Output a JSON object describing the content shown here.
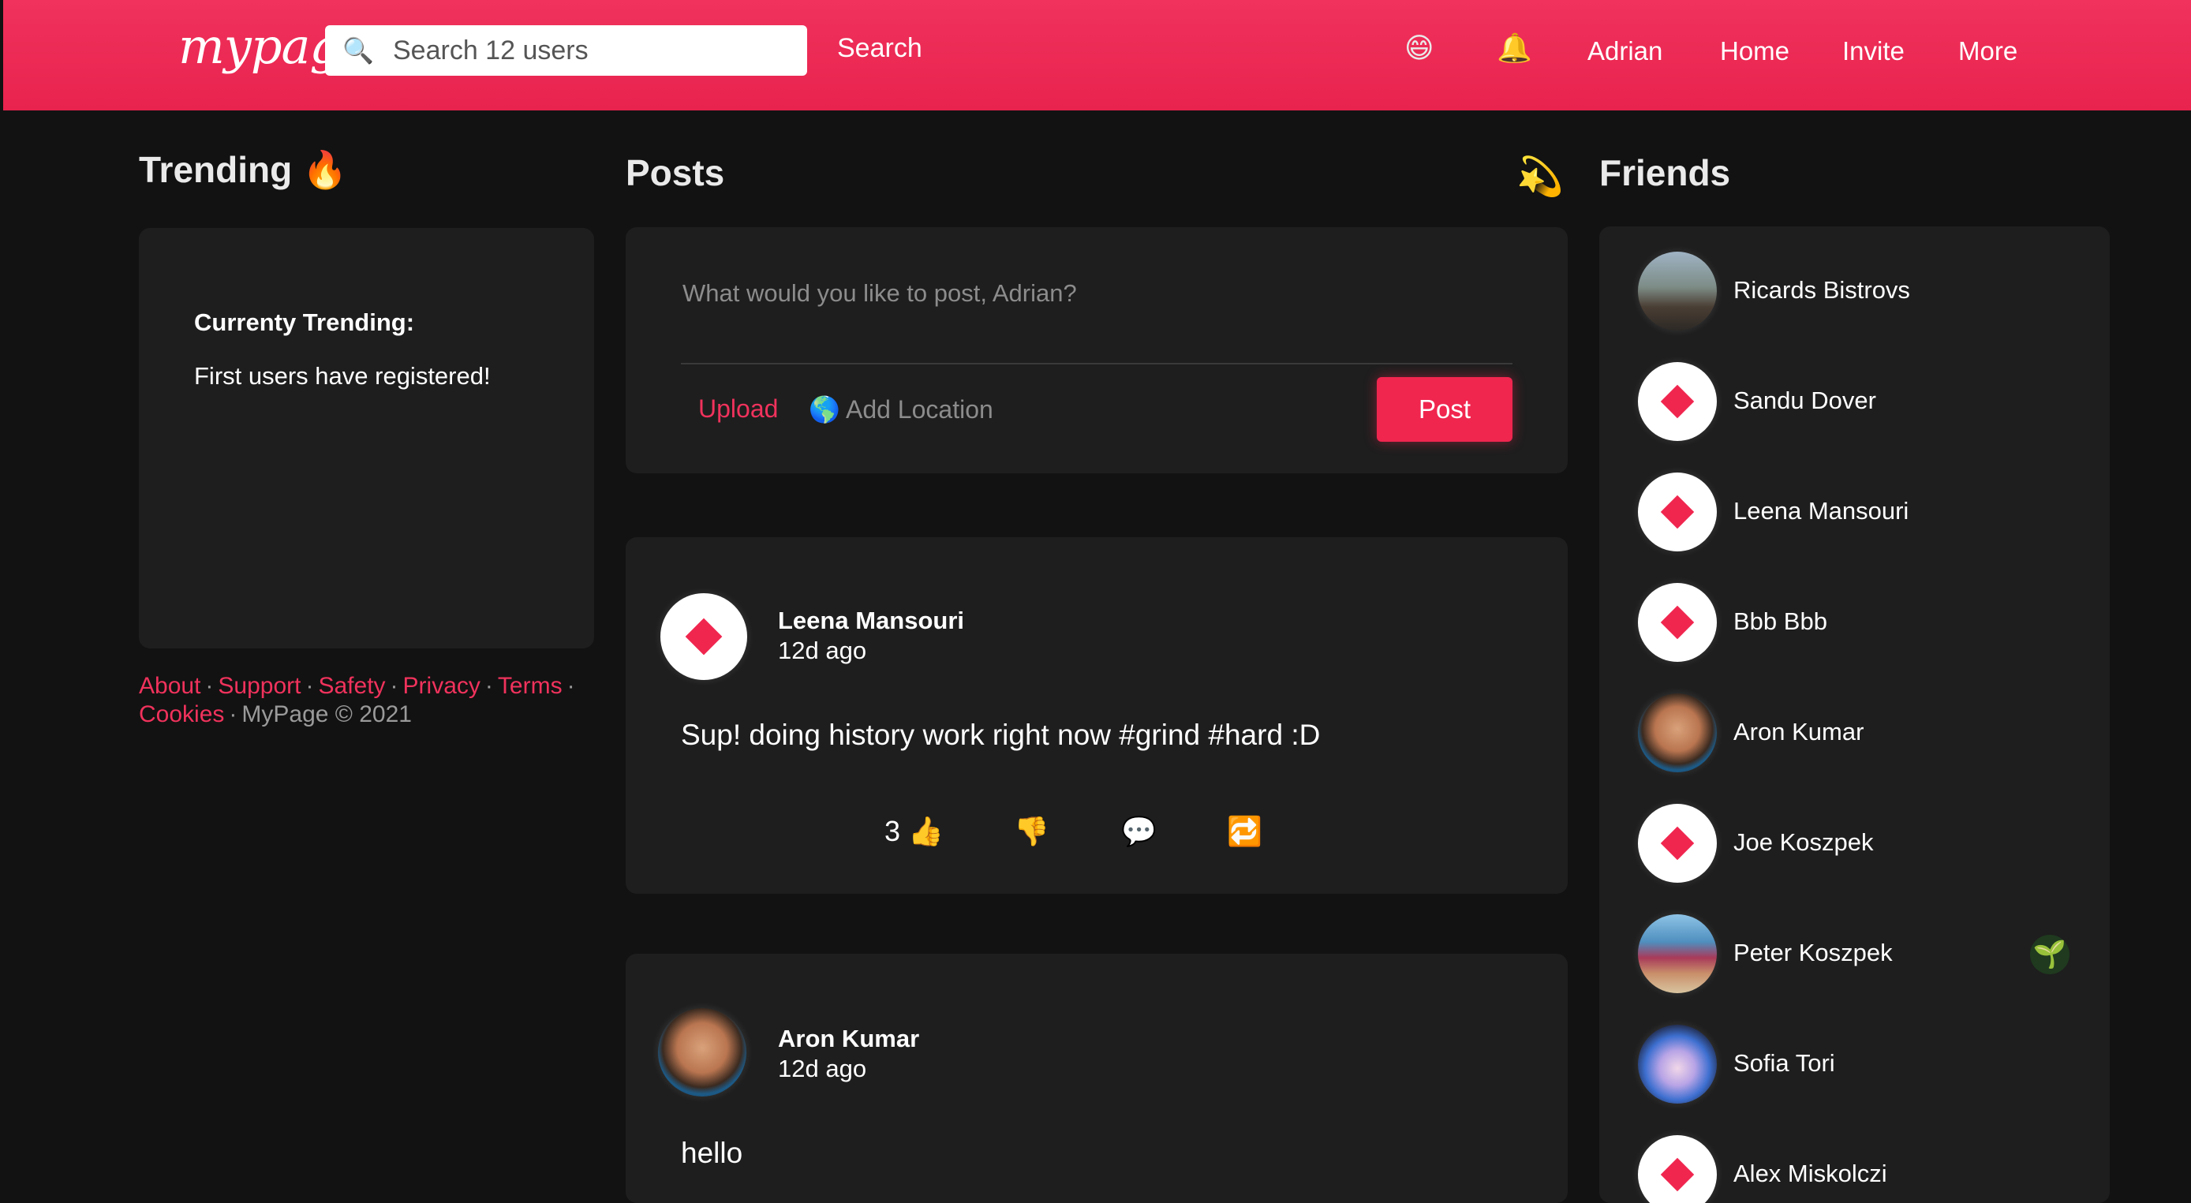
{
  "header": {
    "logo": "mypage",
    "search_placeholder": "Search 12 users",
    "search_button": "Search",
    "emoji_icon": "😄",
    "bell_icon": "🔔",
    "nav": [
      "Adrian",
      "Home",
      "Invite",
      "More"
    ],
    "accent_color": "#f0325c"
  },
  "trending": {
    "title": "Trending 🔥",
    "heading": "Currenty Trending:",
    "text": "First users have registered!"
  },
  "footer": {
    "links": [
      "About",
      "Support",
      "Safety",
      "Privacy",
      "Terms",
      "Cookies"
    ],
    "copyright": "MyPage © 2021"
  },
  "posts_section": {
    "title": "Posts",
    "title_icon": "💫"
  },
  "composer": {
    "placeholder": "What would you like to post, Adrian?",
    "upload": "Upload",
    "location_icon": "🌎",
    "location": "Add Location",
    "post_button": "Post"
  },
  "posts": [
    {
      "author": "Leena Mansouri",
      "time": "12d ago",
      "body": "Sup! doing history work right now #grind #hard :D",
      "likes": "3",
      "like_icon": "👍",
      "dislike_icon": "👎",
      "comment_icon": "💬",
      "repost_icon": "🔁"
    },
    {
      "author": "Aron Kumar",
      "time": "12d ago",
      "body": "hello"
    }
  ],
  "friends": {
    "title": "Friends",
    "list": [
      "Ricards Bistrovs",
      "Sandu Dover",
      "Leena Mansouri",
      "Bbb Bbb",
      "Aron Kumar",
      "Joe Koszpek",
      "Peter Koszpek",
      "Sofia Tori",
      "Alex Miskolczi"
    ],
    "sprout_icon": "🌱"
  }
}
